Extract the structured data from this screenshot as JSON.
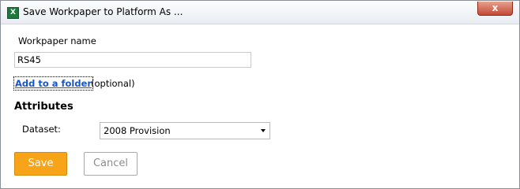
{
  "window": {
    "title": "Save Workpaper to Platform As ...",
    "close_glyph": "x",
    "app_icon": "excel-icon",
    "app_icon_letter": "X"
  },
  "form": {
    "name_label": "Workpaper name",
    "name_value": "RS45",
    "folder_link": "Add to a folder",
    "folder_hint": "(optional)",
    "attributes_title": "Attributes",
    "dataset_label": "Dataset:",
    "dataset_value": "2008 Provision"
  },
  "buttons": {
    "save_label": "Save",
    "cancel_label": "Cancel"
  },
  "colors": {
    "save_button": "#f7a418",
    "link": "#1a56c8",
    "close_button": "#c44a35"
  }
}
